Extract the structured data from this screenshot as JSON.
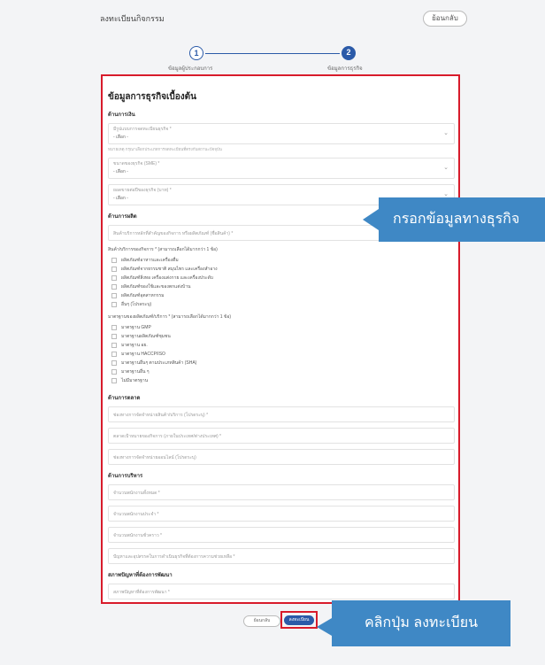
{
  "header": {
    "title": "ลงทะเบียนกิจกรรม",
    "back_label": "ย้อนกลับ"
  },
  "steps": [
    {
      "number": "1",
      "label": "ข้อมูลผู้ประกอบการ"
    },
    {
      "number": "2",
      "label": "ข้อมูลการธุรกิจ"
    }
  ],
  "form": {
    "heading": "ข้อมูลการธุรกิจเบื้องต้น",
    "section_general": "ด้านการเงิน",
    "select1": {
      "label": "มีรูปแบบการจดทะเบียนธุรกิจ *",
      "value": "- เลือก -"
    },
    "select1_hint": "หมายเหตุ กรุณาเลือกประเภทการจดทะเบียนที่ตรงกับสถานะปัจจุบัน",
    "select2": {
      "label": "ขนาดของธุรกิจ (SME) *",
      "value": "- เลือก -"
    },
    "select3": {
      "label": "ยอดขายต่อปีของธุรกิจ (บาท) *",
      "value": "- เลือก -"
    },
    "section_product": "ด้านการผลิต",
    "product_field": "สินค้าบริการหลักที่สำคัญของกิจการ หรือผลิตภัณฑ์ (ชื่อสินค้า) *",
    "product_type_label": "สินค้า/บริการของกิจการ * (สามารถเลือกได้มากกว่า 1 ข้อ)",
    "product_types": [
      "ผลิตภัณฑ์อาหารและเครื่องดื่ม",
      "ผลิตภัณฑ์จากธรรมชาติ สมุนไพร และเครื่องสำอาง",
      "ผลิตภัณฑ์สิ่งทอ เครื่องแต่งกาย และเครื่องประดับ",
      "ผลิตภัณฑ์ของใช้และของตกแต่งบ้าน",
      "ผลิตภัณฑ์อุตสาหกรรม",
      "อื่นๆ (โปรดระบุ)"
    ],
    "standard_label": "มาตรฐานของผลิตภัณฑ์/บริการ * (สามารถเลือกได้มากกว่า 1 ข้อ)",
    "standards": [
      "มาตรฐาน GMP",
      "มาตรฐานผลิตภัณฑ์ชุมชน",
      "มาตรฐาน อย.",
      "มาตรฐาน HACCP/ISO",
      "มาตรฐานอื่นๆ ตามประเภทสินค้า (SHA)",
      "มาตรฐานอื่น ๆ",
      "ไม่มีมาตรฐาน"
    ],
    "section_market": "ด้านการตลาด",
    "market_fields": [
      "ช่องทางการจัดจำหน่ายสินค้า/บริการ (โปรดระบุ) *",
      "ตลาดเป้าหมายของกิจการ (ภายในประเทศ/ต่างประเทศ) *",
      "ช่องทางการจัดจำหน่ายออนไลน์ (โปรดระบุ)"
    ],
    "section_management": "ด้านการบริหาร",
    "management_fields": [
      "จำนวนพนักงานทั้งหมด *",
      "จำนวนพนักงานประจำ *",
      "จำนวนพนักงานชั่วคราว *",
      "ปัญหาและอุปสรรคในการดำเนินธุรกิจที่ต้องการความช่วยเหลือ *"
    ],
    "section_extra": "สภาพปัญหาที่ต้องการพัฒนา",
    "extra_field": "สภาพปัญหาที่ต้องการพัฒนา *"
  },
  "actions": {
    "cancel_label": "ย้อนกลับ",
    "register_label": "ลงทะเบียน"
  },
  "callouts": {
    "business_info": "กรอกข้อมูลทางธุรกิจ",
    "click_register": "คลิกปุ่ม ลงทะเบียน"
  },
  "colors": {
    "accent": "#2b5aa8",
    "highlight": "#d81b2b",
    "callout": "#3f88c5"
  }
}
